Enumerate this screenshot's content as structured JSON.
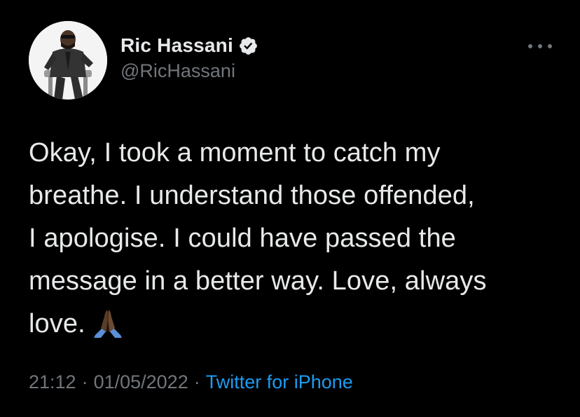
{
  "author": {
    "display_name": "Ric Hassani",
    "handle": "@RicHassani",
    "verified": true,
    "verified_icon": "verified-badge-icon"
  },
  "menu": {
    "icon": "more-horizontal-icon"
  },
  "tweet": {
    "lines": [
      "Okay, I took a moment to catch my",
      "breathe. I understand those offended,",
      "I apologise. I could have passed the",
      "message in a better way. Love, always",
      "love."
    ],
    "emoji": "folded-hands-emoji"
  },
  "meta": {
    "time": "21:12",
    "separator": "·",
    "date": "01/05/2022",
    "source": "Twitter for iPhone"
  },
  "colors": {
    "background": "#000000",
    "text": "#e7e9ea",
    "secondary": "#71767b",
    "link": "#1d9bf0"
  }
}
